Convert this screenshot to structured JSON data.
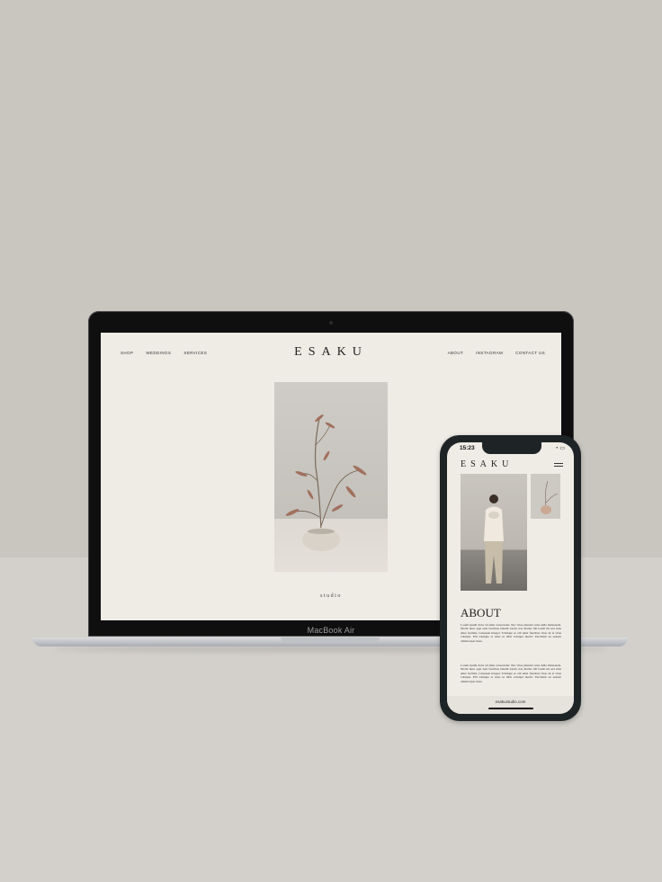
{
  "laptop": {
    "chin_label": "MacBook Air",
    "nav_left": [
      "SHOP",
      "WEDDINGS",
      "SERVICES"
    ],
    "nav_right": [
      "ABOUT",
      "INSTAGRAM",
      "CONTACT US"
    ],
    "brand": "ESAKU",
    "caption": "studio"
  },
  "phone": {
    "time": "15:23",
    "brand": "ESAKU",
    "about_title": "ABOUT",
    "paragraph_1": "Lorem ipsum dolor sit amet consectetur. Nec vitae pharetra urna nulla malesuada. Morbi nunc eget ante faucibus blandit lorem cras mattis. Mi lorem mi sed urna amet facilisis consequat integer. Tristique ac elit amet faucibus vitae sit et vitae volutpat. Elit tristique et risus ut nibh volutpat morbi. Tincidunt eu aenean ullamcorper risus.",
    "paragraph_2": "Lorem ipsum dolor sit amet consectetur. Nec vitae pharetra urna nulla malesuada. Morbi nunc eget ante faucibus blandit lorem cras mattis. Mi lorem mi sed urna amet facilisis consequat integer. Tristique ac elit amet faucibus vitae sit et vitae volutpat. Elit tristique et risus ut nibh volutpat morbi. Tincidunt eu aenean ullamcorper risus.",
    "url": "esakustudio.com"
  }
}
